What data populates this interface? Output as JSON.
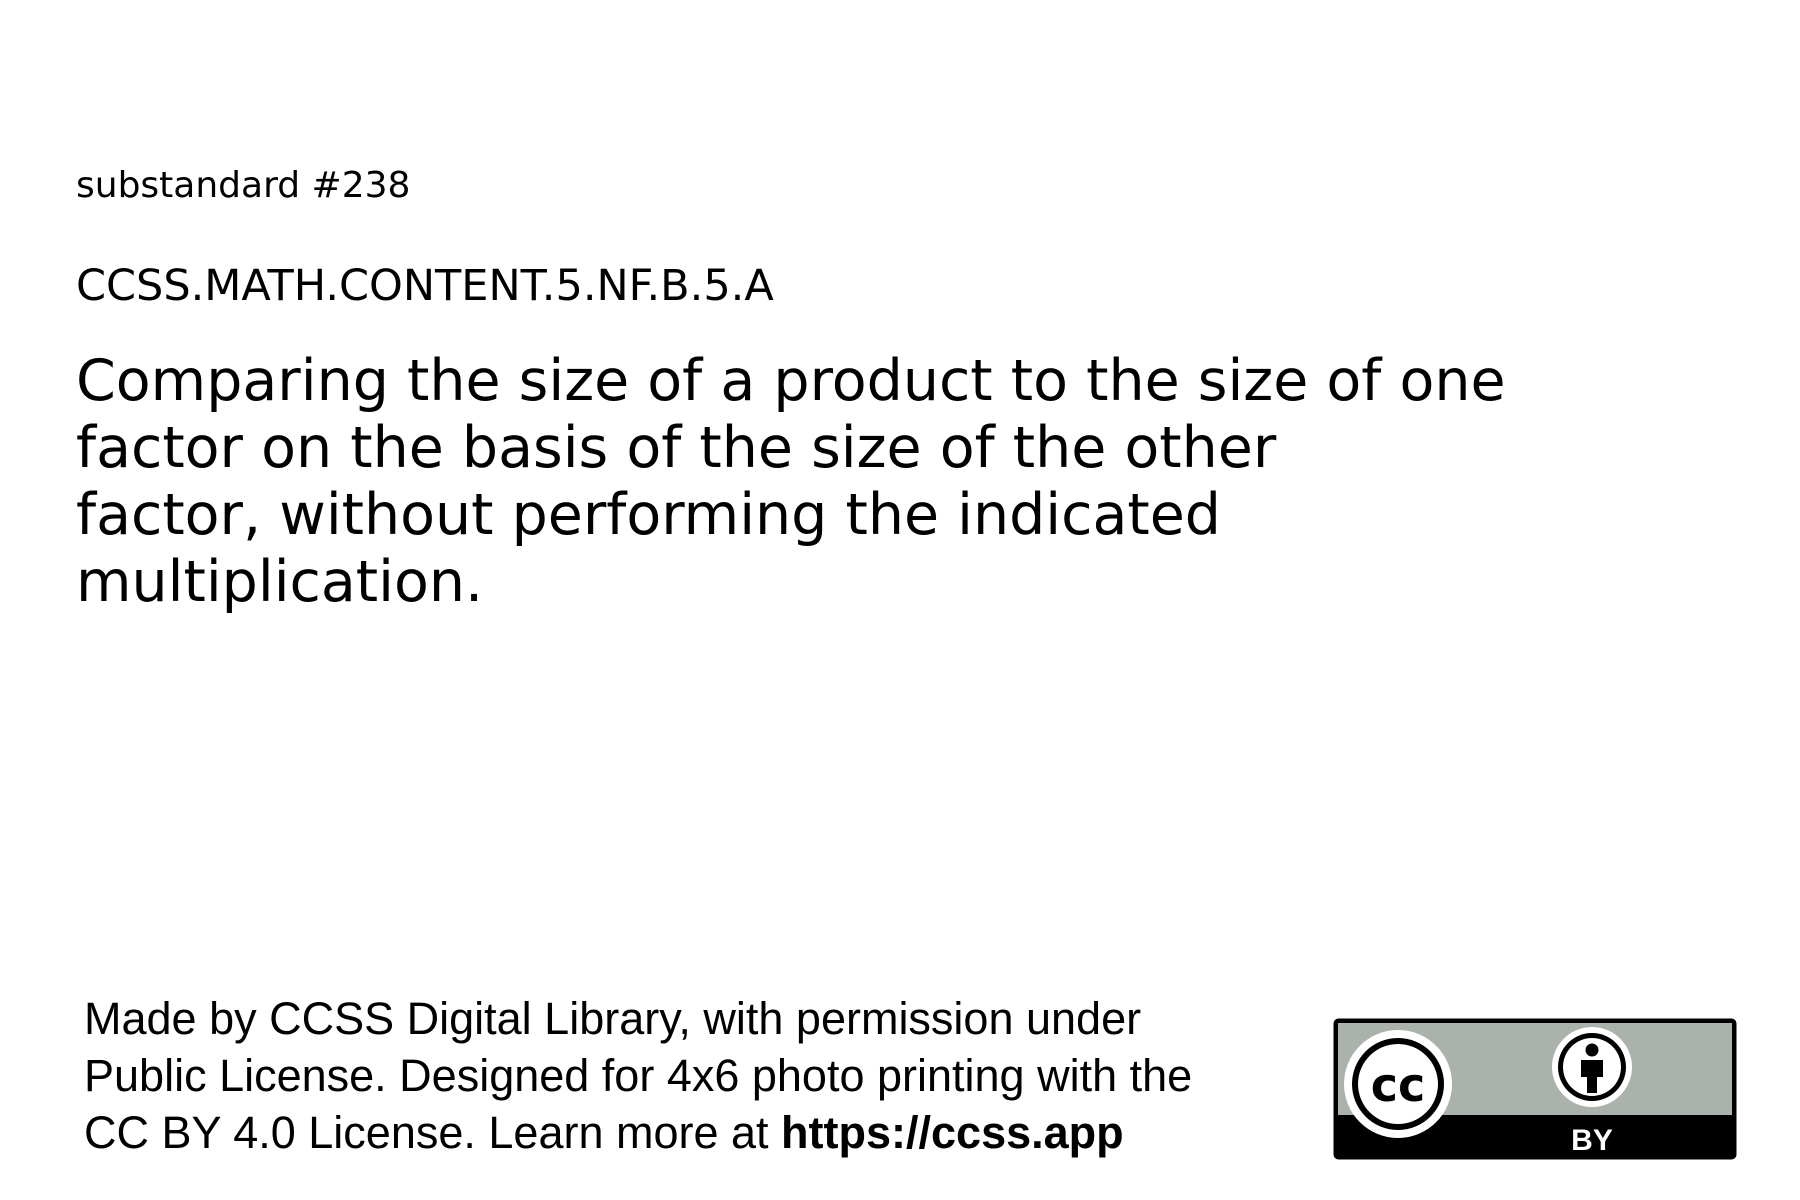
{
  "substandard_label": "substandard #238",
  "standard_code": "CCSS.MATH.CONTENT.5.NF.B.5.A",
  "description_lines": [
    "Comparing the size of a product to the size of one",
    "factor on the basis of the size of the other",
    "factor, without performing the indicated",
    "multiplication."
  ],
  "footer": {
    "line1": "Made by CCSS Digital Library, with permission under",
    "line2": "Public License. Designed for 4x6 photo printing with the",
    "line3_prefix": "CC BY 4.0 License. Learn more at ",
    "link": "https://ccss.app"
  },
  "license_badge": {
    "cc_text": "cc",
    "by_text": "BY",
    "colors": {
      "gray": "#aab2ab",
      "black": "#000000",
      "white": "#ffffff"
    },
    "icons": [
      "cc-icon",
      "attribution-person-icon"
    ]
  }
}
